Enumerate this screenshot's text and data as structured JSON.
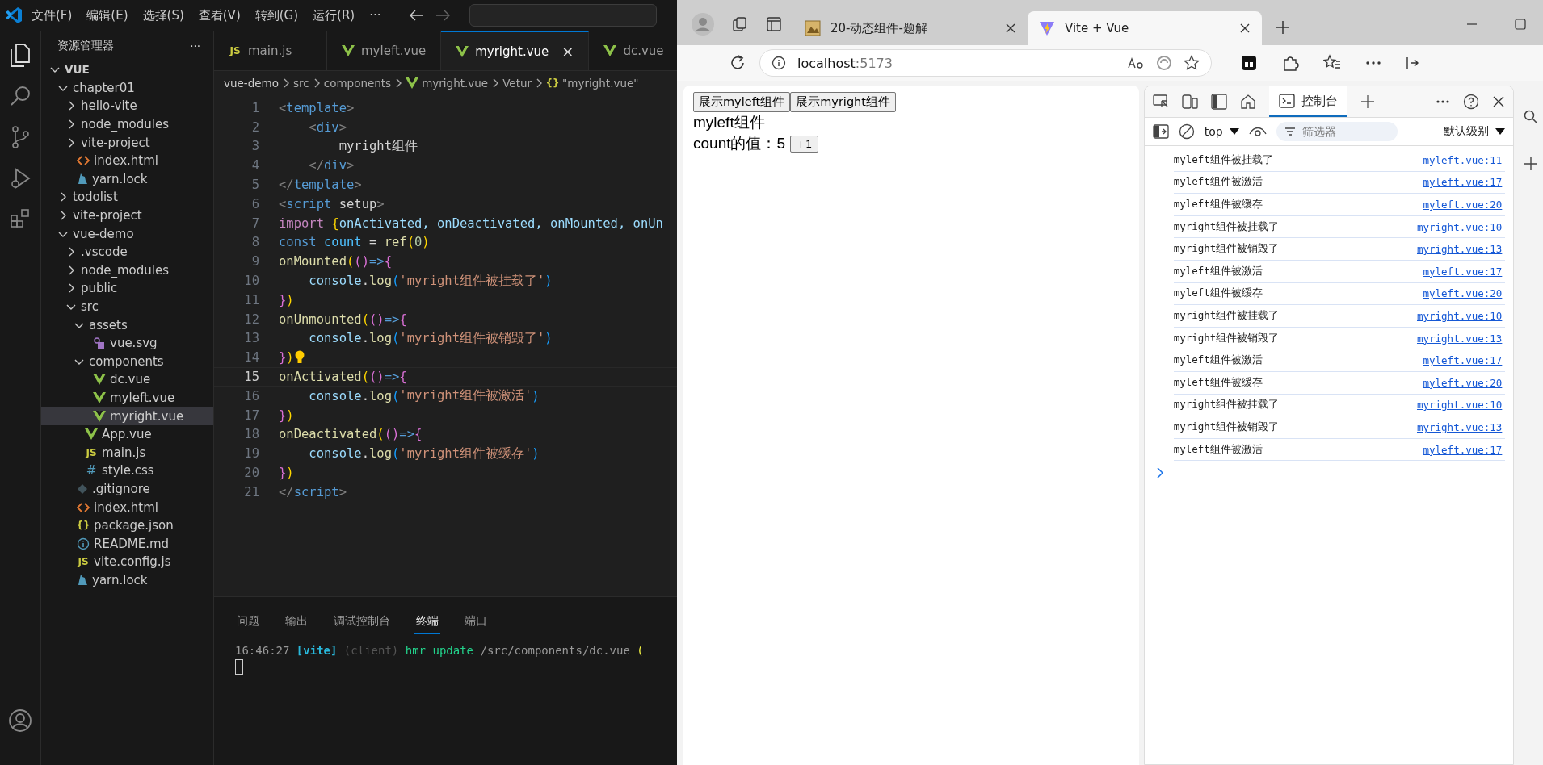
{
  "vscode": {
    "menu": [
      "文件(F)",
      "编辑(E)",
      "选择(S)",
      "查看(V)",
      "转到(G)",
      "运行(R)",
      "···"
    ],
    "explorer": {
      "title": "资源管理器",
      "more": "···",
      "root": {
        "name": "VUE",
        "expanded": true,
        "children": [
          {
            "name": "chapter01",
            "kind": "folder",
            "expanded": true,
            "selected": false,
            "children": [
              {
                "name": "hello-vite",
                "kind": "folder",
                "expanded": false,
                "selected": false
              },
              {
                "name": "node_modules",
                "kind": "folder",
                "expanded": false,
                "selected": false
              },
              {
                "name": "vite-project",
                "kind": "folder",
                "expanded": false,
                "selected": false
              },
              {
                "name": "index.html",
                "kind": "html",
                "selected": false
              },
              {
                "name": "yarn.lock",
                "kind": "yarn",
                "selected": false
              }
            ]
          },
          {
            "name": "todolist",
            "kind": "folder",
            "expanded": false,
            "selected": false
          },
          {
            "name": "vite-project",
            "kind": "folder",
            "expanded": false,
            "selected": false
          },
          {
            "name": "vue-demo",
            "kind": "folder",
            "expanded": true,
            "selected": false,
            "children": [
              {
                "name": ".vscode",
                "kind": "folder",
                "expanded": false,
                "selected": false
              },
              {
                "name": "node_modules",
                "kind": "folder",
                "expanded": false,
                "selected": false
              },
              {
                "name": "public",
                "kind": "folder",
                "expanded": false,
                "selected": false
              },
              {
                "name": "src",
                "kind": "folder",
                "expanded": true,
                "selected": false,
                "children": [
                  {
                    "name": "assets",
                    "kind": "folder",
                    "expanded": true,
                    "selected": false,
                    "children": [
                      {
                        "name": "vue.svg",
                        "kind": "svg",
                        "selected": false
                      }
                    ]
                  },
                  {
                    "name": "components",
                    "kind": "folder",
                    "expanded": true,
                    "selected": false,
                    "children": [
                      {
                        "name": "dc.vue",
                        "kind": "vue",
                        "selected": false
                      },
                      {
                        "name": "myleft.vue",
                        "kind": "vue",
                        "selected": false
                      },
                      {
                        "name": "myright.vue",
                        "kind": "vue",
                        "selected": true
                      }
                    ]
                  },
                  {
                    "name": "App.vue",
                    "kind": "vue",
                    "selected": false
                  },
                  {
                    "name": "main.js",
                    "kind": "js",
                    "badge": "JS",
                    "selected": false
                  },
                  {
                    "name": "style.css",
                    "kind": "css",
                    "badge": "#",
                    "selected": false
                  }
                ]
              },
              {
                "name": ".gitignore",
                "kind": "git",
                "selected": false
              },
              {
                "name": "index.html",
                "kind": "html",
                "selected": false
              },
              {
                "name": "package.json",
                "kind": "json",
                "badge": "{}",
                "selected": false
              },
              {
                "name": "README.md",
                "kind": "info",
                "selected": false
              },
              {
                "name": "vite.config.js",
                "kind": "js",
                "badge": "JS",
                "selected": false
              },
              {
                "name": "yarn.lock",
                "kind": "yarn",
                "selected": false
              }
            ]
          }
        ]
      }
    },
    "tabs": [
      {
        "label": "main.js",
        "kind": "js",
        "badge": "JS",
        "selected": false
      },
      {
        "label": "myleft.vue",
        "kind": "vue",
        "selected": false
      },
      {
        "label": "myright.vue",
        "kind": "vue",
        "selected": true,
        "close": "×"
      },
      {
        "label": "dc.vue",
        "kind": "vue",
        "selected": false
      }
    ],
    "breadcrumb": [
      {
        "text": "vue-demo"
      },
      {
        "text": "src"
      },
      {
        "text": "components"
      },
      {
        "text": "myright.vue",
        "kind": "vue"
      },
      {
        "text": "Vetur"
      },
      {
        "text": "\"myright.vue\"",
        "kind": "braces",
        "badge": "{}"
      }
    ],
    "code": [
      {
        "num": "1",
        "current": false,
        "tokens": [
          {
            "text": "<",
            "kind": "p"
          },
          {
            "text": "template",
            "kind": "tag"
          },
          {
            "text": ">",
            "kind": "p"
          }
        ]
      },
      {
        "num": "2",
        "current": false,
        "tokens": [
          {
            "text": "    <",
            "kind": "p"
          },
          {
            "text": "div",
            "kind": "tag"
          },
          {
            "text": ">",
            "kind": "p"
          }
        ]
      },
      {
        "num": "3",
        "current": false,
        "tokens": [
          {
            "text": "        myright组件",
            "kind": "plain"
          }
        ]
      },
      {
        "num": "4",
        "current": false,
        "tokens": [
          {
            "text": "    </",
            "kind": "p"
          },
          {
            "text": "div",
            "kind": "tag"
          },
          {
            "text": ">",
            "kind": "p"
          }
        ]
      },
      {
        "num": "5",
        "current": false,
        "tokens": [
          {
            "text": "</",
            "kind": "p"
          },
          {
            "text": "template",
            "kind": "tag"
          },
          {
            "text": ">",
            "kind": "p"
          }
        ]
      },
      {
        "num": "6",
        "current": false,
        "tokens": [
          {
            "text": "<",
            "kind": "p"
          },
          {
            "text": "script",
            "kind": "tag"
          },
          {
            "text": " setup",
            "kind": "plain"
          },
          {
            "text": ">",
            "kind": "p"
          }
        ]
      },
      {
        "num": "7",
        "current": false,
        "tokens": [
          {
            "text": "import ",
            "kind": "kw"
          },
          {
            "text": "{",
            "kind": "b1"
          },
          {
            "text": "onActivated, onDeactivated, onMounted, onUn",
            "kind": "var"
          }
        ]
      },
      {
        "num": "8",
        "current": false,
        "tokens": [
          {
            "text": "const ",
            "kind": "storage"
          },
          {
            "text": "count",
            "kind": "const"
          },
          {
            "text": " = ",
            "kind": "plain"
          },
          {
            "text": "ref",
            "kind": "fn"
          },
          {
            "text": "(",
            "kind": "b1"
          },
          {
            "text": "0",
            "kind": "num"
          },
          {
            "text": ")",
            "kind": "b1"
          }
        ]
      },
      {
        "num": "9",
        "current": false,
        "tokens": [
          {
            "text": "onMounted",
            "kind": "fn"
          },
          {
            "text": "(",
            "kind": "b1"
          },
          {
            "text": "()",
            "kind": "b2"
          },
          {
            "text": "=>",
            "kind": "storage"
          },
          {
            "text": "{",
            "kind": "b2"
          }
        ]
      },
      {
        "num": "10",
        "current": false,
        "tokens": [
          {
            "text": "    console",
            "kind": "var"
          },
          {
            "text": ".",
            "kind": "plain"
          },
          {
            "text": "log",
            "kind": "fn"
          },
          {
            "text": "(",
            "kind": "b3"
          },
          {
            "text": "'myright组件被挂载了'",
            "kind": "str"
          },
          {
            "text": ")",
            "kind": "b3"
          }
        ]
      },
      {
        "num": "11",
        "current": false,
        "tokens": [
          {
            "text": "}",
            "kind": "b2"
          },
          {
            "text": ")",
            "kind": "b1"
          }
        ]
      },
      {
        "num": "12",
        "current": false,
        "tokens": [
          {
            "text": "onUnmounted",
            "kind": "fn"
          },
          {
            "text": "(",
            "kind": "b1"
          },
          {
            "text": "()",
            "kind": "b2"
          },
          {
            "text": "=>",
            "kind": "storage"
          },
          {
            "text": "{",
            "kind": "b2"
          }
        ]
      },
      {
        "num": "13",
        "current": false,
        "tokens": [
          {
            "text": "    console",
            "kind": "var"
          },
          {
            "text": ".",
            "kind": "plain"
          },
          {
            "text": "log",
            "kind": "fn"
          },
          {
            "text": "(",
            "kind": "b3"
          },
          {
            "text": "'myright组件被销毁了'",
            "kind": "str"
          },
          {
            "text": ")",
            "kind": "b3"
          }
        ]
      },
      {
        "num": "14",
        "current": false,
        "bulb": true,
        "tokens": [
          {
            "text": "}",
            "kind": "b2"
          },
          {
            "text": ")",
            "kind": "b1"
          }
        ]
      },
      {
        "num": "15",
        "current": true,
        "tokens": [
          {
            "text": "onActivated",
            "kind": "fn"
          },
          {
            "text": "(",
            "kind": "b1"
          },
          {
            "text": "()",
            "kind": "b2"
          },
          {
            "text": "=>",
            "kind": "storage"
          },
          {
            "text": "{",
            "kind": "b2"
          }
        ]
      },
      {
        "num": "16",
        "current": false,
        "tokens": [
          {
            "text": "    console",
            "kind": "var"
          },
          {
            "text": ".",
            "kind": "plain"
          },
          {
            "text": "log",
            "kind": "fn"
          },
          {
            "text": "(",
            "kind": "b3"
          },
          {
            "text": "'myright组件被激活'",
            "kind": "str"
          },
          {
            "text": ")",
            "kind": "b3"
          }
        ]
      },
      {
        "num": "17",
        "current": false,
        "tokens": [
          {
            "text": "}",
            "kind": "b2"
          },
          {
            "text": ")",
            "kind": "b1"
          }
        ]
      },
      {
        "num": "18",
        "current": false,
        "tokens": [
          {
            "text": "onDeactivated",
            "kind": "fn"
          },
          {
            "text": "(",
            "kind": "b1"
          },
          {
            "text": "()",
            "kind": "b2"
          },
          {
            "text": "=>",
            "kind": "storage"
          },
          {
            "text": "{",
            "kind": "b2"
          }
        ]
      },
      {
        "num": "19",
        "current": false,
        "tokens": [
          {
            "text": "    console",
            "kind": "var"
          },
          {
            "text": ".",
            "kind": "plain"
          },
          {
            "text": "log",
            "kind": "fn"
          },
          {
            "text": "(",
            "kind": "b3"
          },
          {
            "text": "'myright组件被缓存'",
            "kind": "str"
          },
          {
            "text": ")",
            "kind": "b3"
          }
        ]
      },
      {
        "num": "20",
        "current": false,
        "tokens": [
          {
            "text": "}",
            "kind": "b2"
          },
          {
            "text": ")",
            "kind": "b1"
          }
        ]
      },
      {
        "num": "21",
        "current": false,
        "tokens": [
          {
            "text": "</",
            "kind": "p"
          },
          {
            "text": "script",
            "kind": "tag"
          },
          {
            "text": ">",
            "kind": "p"
          }
        ]
      }
    ],
    "panel": {
      "tabs": [
        {
          "label": "问题",
          "selected": false
        },
        {
          "label": "输出",
          "selected": false
        },
        {
          "label": "调试控制台",
          "selected": false
        },
        {
          "label": "终端",
          "selected": true
        },
        {
          "label": "端口",
          "selected": false
        }
      ],
      "terminal": [
        {
          "text": "16:46:27 ",
          "kind": "time"
        },
        {
          "text": "[vite]",
          "kind": "vite"
        },
        {
          "text": " (client) ",
          "kind": "dim"
        },
        {
          "text": "hmr update ",
          "kind": "green"
        },
        {
          "text": "/src/components/dc.vue ",
          "kind": "path"
        },
        {
          "text": "(",
          "kind": "yellow"
        }
      ]
    }
  },
  "browser": {
    "tabs": [
      {
        "title": "20-动态组件-题解",
        "kind": "photo",
        "selected": false
      },
      {
        "title": "Vite + Vue",
        "kind": "vite",
        "selected": true
      }
    ],
    "address": {
      "host": "localhost",
      "port": ":5173"
    },
    "page": {
      "buttons": [
        "展示myleft组件",
        "展示myright组件"
      ],
      "heading": "myleft组件",
      "count_label": "count的值：5",
      "increment": "+1"
    },
    "devtools": {
      "tabs": [
        {
          "label": "控制台",
          "selected": true
        }
      ],
      "context": "top",
      "filter": {
        "placeholder": "筛选器"
      },
      "level": "默认级别",
      "messages": [
        {
          "text": "myleft组件被挂载了",
          "source": "myleft.vue:11"
        },
        {
          "text": "myleft组件被激活",
          "source": "myleft.vue:17"
        },
        {
          "text": "myleft组件被缓存",
          "source": "myleft.vue:20"
        },
        {
          "text": "myright组件被挂载了",
          "source": "myright.vue:10"
        },
        {
          "text": "myright组件被销毁了",
          "source": "myright.vue:13"
        },
        {
          "text": "myleft组件被激活",
          "source": "myleft.vue:17"
        },
        {
          "text": "myleft组件被缓存",
          "source": "myleft.vue:20"
        },
        {
          "text": "myright组件被挂载了",
          "source": "myright.vue:10"
        },
        {
          "text": "myright组件被销毁了",
          "source": "myright.vue:13"
        },
        {
          "text": "myleft组件被激活",
          "source": "myleft.vue:17"
        },
        {
          "text": "myleft组件被缓存",
          "source": "myleft.vue:20"
        },
        {
          "text": "myright组件被挂载了",
          "source": "myright.vue:10"
        },
        {
          "text": "myright组件被销毁了",
          "source": "myright.vue:13"
        },
        {
          "text": "myleft组件被激活",
          "source": "myleft.vue:17"
        }
      ]
    }
  }
}
